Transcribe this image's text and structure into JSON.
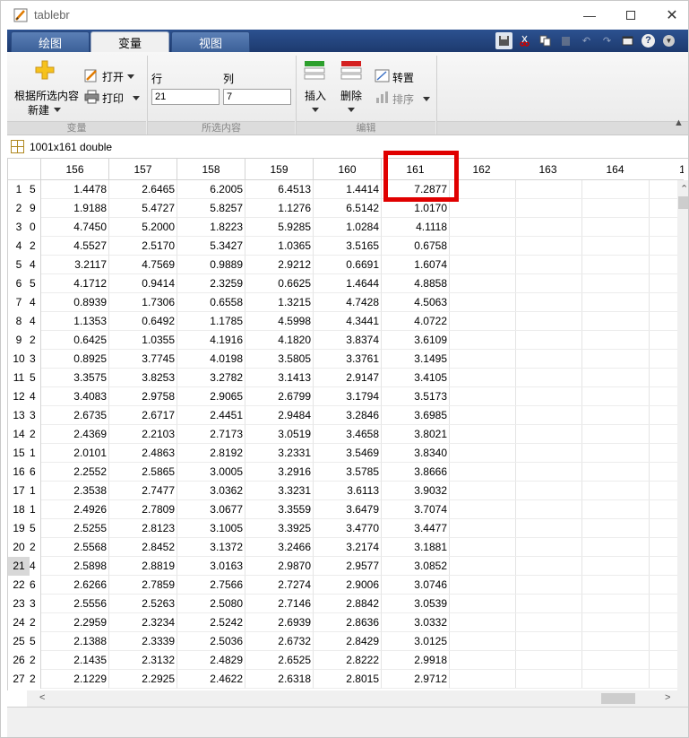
{
  "window": {
    "title": "tablebr"
  },
  "tabs": [
    {
      "label": "绘图",
      "active": false
    },
    {
      "label": "变量",
      "active": true
    },
    {
      "label": "视图",
      "active": false
    }
  ],
  "ribbon": {
    "new_from_selection_line1": "根据所选内容",
    "new_from_selection_line2": "新建",
    "open_label": "打开",
    "print_label": "打印",
    "row_label": "行",
    "col_label": "列",
    "row_value": "21",
    "col_value": "7",
    "insert_label": "插入",
    "delete_label": "删除",
    "transpose_label": "转置",
    "sort_label": "排序",
    "section_variable": "变量",
    "section_selection": "所选内容",
    "section_edit": "编辑"
  },
  "variable": {
    "description": "1001x161 double"
  },
  "grid": {
    "columns": [
      "156",
      "157",
      "158",
      "159",
      "160",
      "161",
      "162",
      "163",
      "164",
      "1"
    ],
    "selected_row": 21,
    "partial_col_glyphs": [
      "5",
      "9",
      "0",
      "2",
      "4",
      "5",
      "4",
      "4",
      "2",
      "3",
      "5",
      "4",
      "3",
      "2",
      "1",
      "6",
      "1",
      "1",
      "5",
      "2",
      "4",
      "6",
      "3",
      "2",
      "5",
      "2",
      "2"
    ],
    "rows": [
      [
        "1",
        "1.4478",
        "2.6465",
        "6.2005",
        "6.4513",
        "1.4414",
        "7.2877"
      ],
      [
        "2",
        "1.9188",
        "5.4727",
        "5.8257",
        "1.1276",
        "6.5142",
        "1.0170"
      ],
      [
        "3",
        "4.7450",
        "5.2000",
        "1.8223",
        "5.9285",
        "1.0284",
        "4.1118"
      ],
      [
        "4",
        "4.5527",
        "2.5170",
        "5.3427",
        "1.0365",
        "3.5165",
        "0.6758"
      ],
      [
        "5",
        "3.2117",
        "4.7569",
        "0.9889",
        "2.9212",
        "0.6691",
        "1.6074"
      ],
      [
        "6",
        "4.1712",
        "0.9414",
        "2.3259",
        "0.6625",
        "1.4644",
        "4.8858"
      ],
      [
        "7",
        "0.8939",
        "1.7306",
        "0.6558",
        "1.3215",
        "4.7428",
        "4.5063"
      ],
      [
        "8",
        "1.1353",
        "0.6492",
        "1.1785",
        "4.5998",
        "4.3441",
        "4.0722"
      ],
      [
        "9",
        "0.6425",
        "1.0355",
        "4.1916",
        "4.1820",
        "3.8374",
        "3.6109"
      ],
      [
        "10",
        "0.8925",
        "3.7745",
        "4.0198",
        "3.5805",
        "3.3761",
        "3.1495"
      ],
      [
        "11",
        "3.3575",
        "3.8253",
        "3.2782",
        "3.1413",
        "2.9147",
        "3.4105"
      ],
      [
        "12",
        "3.4083",
        "2.9758",
        "2.9065",
        "2.6799",
        "3.1794",
        "3.5173"
      ],
      [
        "13",
        "2.6735",
        "2.6717",
        "2.4451",
        "2.9484",
        "3.2846",
        "3.6985"
      ],
      [
        "14",
        "2.4369",
        "2.2103",
        "2.7173",
        "3.0519",
        "3.4658",
        "3.8021"
      ],
      [
        "15",
        "2.0101",
        "2.4863",
        "2.8192",
        "3.2331",
        "3.5469",
        "3.8340"
      ],
      [
        "16",
        "2.2552",
        "2.5865",
        "3.0005",
        "3.2916",
        "3.5785",
        "3.8666"
      ],
      [
        "17",
        "2.3538",
        "2.7477",
        "3.0362",
        "3.3231",
        "3.6113",
        "3.9032"
      ],
      [
        "18",
        "2.4926",
        "2.7809",
        "3.0677",
        "3.3559",
        "3.6479",
        "3.7074"
      ],
      [
        "19",
        "2.5255",
        "2.8123",
        "3.1005",
        "3.3925",
        "3.4770",
        "3.4477"
      ],
      [
        "20",
        "2.5568",
        "2.8452",
        "3.1372",
        "3.2466",
        "3.2174",
        "3.1881"
      ],
      [
        "21",
        "2.5898",
        "2.8819",
        "3.0163",
        "2.9870",
        "2.9577",
        "3.0852"
      ],
      [
        "22",
        "2.6266",
        "2.7859",
        "2.7566",
        "2.7274",
        "2.9006",
        "3.0746"
      ],
      [
        "23",
        "2.5556",
        "2.5263",
        "2.5080",
        "2.7146",
        "2.8842",
        "3.0539"
      ],
      [
        "24",
        "2.2959",
        "2.3234",
        "2.5242",
        "2.6939",
        "2.8636",
        "3.0332"
      ],
      [
        "25",
        "2.1388",
        "2.3339",
        "2.5036",
        "2.6732",
        "2.8429",
        "3.0125"
      ],
      [
        "26",
        "2.1435",
        "2.3132",
        "2.4829",
        "2.6525",
        "2.8222",
        "2.9918"
      ],
      [
        "27",
        "2.1229",
        "2.2925",
        "2.4622",
        "2.6318",
        "2.8015",
        "2.9712"
      ]
    ]
  },
  "colors": {
    "tab_bar": "#1d3a6e",
    "highlight": "#e00000",
    "selected_row_header": "#d8d8d8"
  }
}
